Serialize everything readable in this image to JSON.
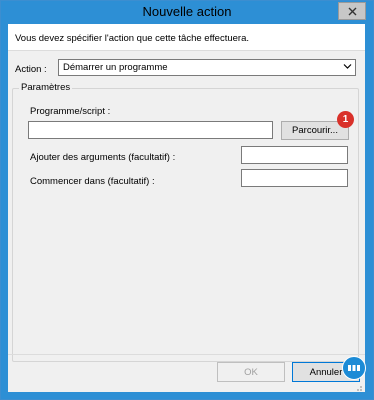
{
  "window": {
    "title": "Nouvelle action"
  },
  "dialog": {
    "description": "Vous devez spécifier l'action que cette tâche effectuera.",
    "action_label": "Action :",
    "action_value": "Démarrer un programme",
    "parameters_legend": "Paramètres",
    "program_label": "Programme/script :",
    "program_value": "",
    "browse_label": "Parcourir...",
    "badge_number": "1",
    "arguments_label": "Ajouter des arguments (facultatif) :",
    "arguments_value": "",
    "start_in_label": "Commencer dans (facultatif) :",
    "start_in_value": "",
    "ok_label": "OK",
    "cancel_label": "Annuler"
  },
  "icons": {
    "close": "close-icon",
    "dropdown": "chevron-down-icon",
    "logo": "logo-icon",
    "resize": "resize-grip-icon"
  },
  "colors": {
    "titlebar": "#2d8fd5",
    "client_bg": "#f0f0f0",
    "badge": "#d9312a",
    "cancel_border": "#0078d7",
    "logo": "#1c8bd6"
  }
}
